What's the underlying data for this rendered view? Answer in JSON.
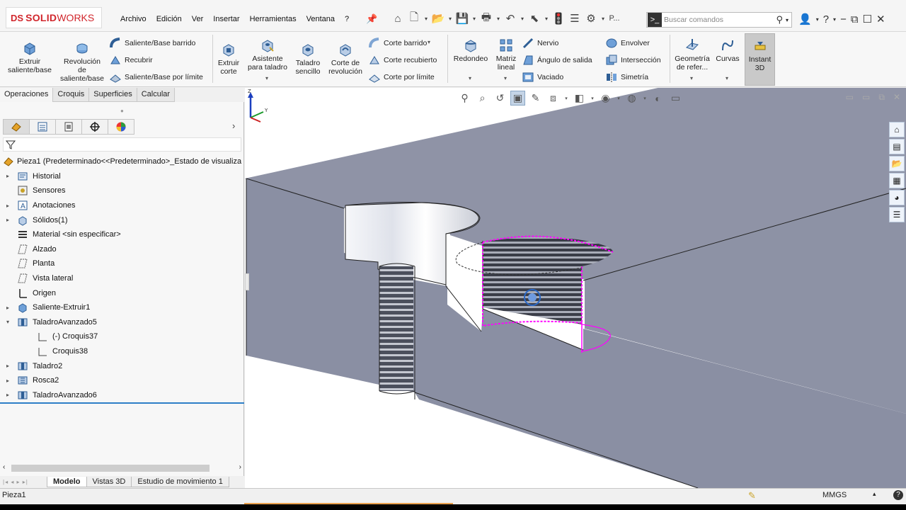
{
  "app": {
    "logo_prefix": "DS",
    "logo_name_bold": "SOLID",
    "logo_name_light": "WORKS",
    "menus": [
      "Archivo",
      "Edición",
      "Ver",
      "Insertar",
      "Herramientas",
      "Ventana",
      "?"
    ],
    "quick_access_overflow_label": "P...",
    "search_placeholder": "Buscar comandos",
    "colors": {
      "brand_red": "#d1262c",
      "selection_magenta": "#ff00ff",
      "model_face": "#8f94a8",
      "tree_accent": "#2d7fc7"
    }
  },
  "ribbon": {
    "features": {
      "extrude_boss": "Extruir\nsaliente/base",
      "revolve_boss": "Revolución\nde\nsaliente/base",
      "swept_boss": "Saliente/Base barrido",
      "loft_boss": "Recubrir",
      "boundary_boss": "Saliente/Base por límite",
      "extrude_cut": "Extruir\ncorte",
      "hole_wizard": "Asistente\npara taladro",
      "simple_hole": "Taladro\nsencillo",
      "revolve_cut": "Corte de\nrevolución",
      "swept_cut": "Corte barrido",
      "lofted_cut": "Corte recubierto",
      "boundary_cut": "Corte por límite",
      "fillet": "Redondeo",
      "linear_pattern": "Matriz\nlineal",
      "rib": "Nervio",
      "draft": "Ángulo de salida",
      "shell": "Vaciado",
      "wrap": "Envolver",
      "intersect": "Intersección",
      "mirror": "Simetría",
      "ref_geometry": "Geometría\nde refer...",
      "curves": "Curvas",
      "instant3d": "Instant\n3D"
    }
  },
  "left_panel": {
    "tabs": [
      "Operaciones",
      "Croquis",
      "Superficies",
      "Calcular"
    ],
    "active_tab": "Operaciones",
    "tree": [
      {
        "label": "Pieza1  (Predeterminado<<Predeterminado>_Estado de visualiza",
        "icon": "part-icon",
        "expander": ""
      },
      {
        "label": "Historial",
        "icon": "history-icon",
        "expander": "▸"
      },
      {
        "label": "Sensores",
        "icon": "sensor-icon",
        "expander": ""
      },
      {
        "label": "Anotaciones",
        "icon": "annotation-icon",
        "expander": "▸"
      },
      {
        "label": "Sólidos(1)",
        "icon": "solid-bodies-icon",
        "expander": "▸"
      },
      {
        "label": "Material <sin especificar>",
        "icon": "material-icon",
        "expander": ""
      },
      {
        "label": "Alzado",
        "icon": "plane-icon",
        "expander": ""
      },
      {
        "label": "Planta",
        "icon": "plane-icon",
        "expander": ""
      },
      {
        "label": "Vista lateral",
        "icon": "plane-icon",
        "expander": ""
      },
      {
        "label": "Origen",
        "icon": "origin-icon",
        "expander": ""
      },
      {
        "label": "Saliente-Extruir1",
        "icon": "extrude-icon",
        "expander": "▸"
      },
      {
        "label": "TaladroAvanzado5",
        "icon": "hole-icon",
        "expander": "▾"
      },
      {
        "label": "(-) Croquis37",
        "icon": "sketch-icon",
        "expander": "",
        "child": true
      },
      {
        "label": "Croquis38",
        "icon": "sketch-icon",
        "expander": "",
        "child": true
      },
      {
        "label": "Taladro2",
        "icon": "hole-icon",
        "expander": "▸"
      },
      {
        "label": "Rosca2",
        "icon": "thread-icon",
        "expander": "▸"
      },
      {
        "label": "TaladroAvanzado6",
        "icon": "hole-icon",
        "expander": "▸"
      }
    ],
    "bottom_tabs": [
      "Modelo",
      "Vistas 3D",
      "Estudio de movimiento 1"
    ],
    "active_bottom_tab": "Modelo"
  },
  "viewport": {
    "triad_labels": {
      "z": "Z",
      "y": "Y"
    }
  },
  "status_bar": {
    "document": "Pieza1",
    "units": "MMGS",
    "help": "?"
  }
}
